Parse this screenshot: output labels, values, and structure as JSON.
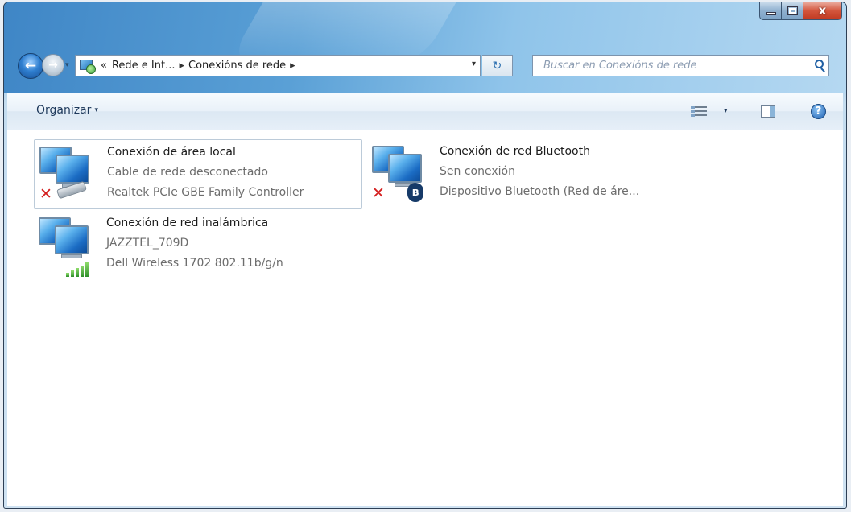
{
  "window": {
    "minimize": "minimize",
    "maximize": "maximize",
    "close": "x"
  },
  "nav": {
    "back_glyph": "←",
    "forward_glyph": "→",
    "recent_glyph": "▾"
  },
  "address": {
    "overflow": "«",
    "crumbs": [
      "Rede e Int...",
      "Conexións de rede"
    ],
    "separator": "▸",
    "dropdown_glyph": "▾",
    "refresh_glyph": "↻"
  },
  "search": {
    "placeholder": "Buscar en Conexións de rede"
  },
  "toolbar": {
    "organize_label": "Organizar",
    "organize_arrow": "▾",
    "views_arrow": "▾",
    "help_glyph": "?"
  },
  "connections": [
    {
      "name": "Conexión de área local",
      "status": "Cable de rede desconectado",
      "device": "Realtek PCIe GBE Family Controller",
      "icon": "wired-disconnected",
      "x_glyph": "✕"
    },
    {
      "name": "Conexión de red Bluetooth",
      "status": "Sen conexión",
      "device": "Dispositivo Bluetooth (Red de áre...",
      "icon": "bluetooth-disconnected",
      "x_glyph": "✕",
      "bt_glyph": "ʙ"
    },
    {
      "name": "Conexión de red inalámbrica",
      "status": "JAZZTEL_709D",
      "device": "Dell Wireless 1702 802.11b/g/n",
      "icon": "wireless-connected"
    }
  ],
  "colors": {
    "accent": "#1f5fa3",
    "error": "#d41e1e",
    "signal": "#2e8f2a"
  }
}
